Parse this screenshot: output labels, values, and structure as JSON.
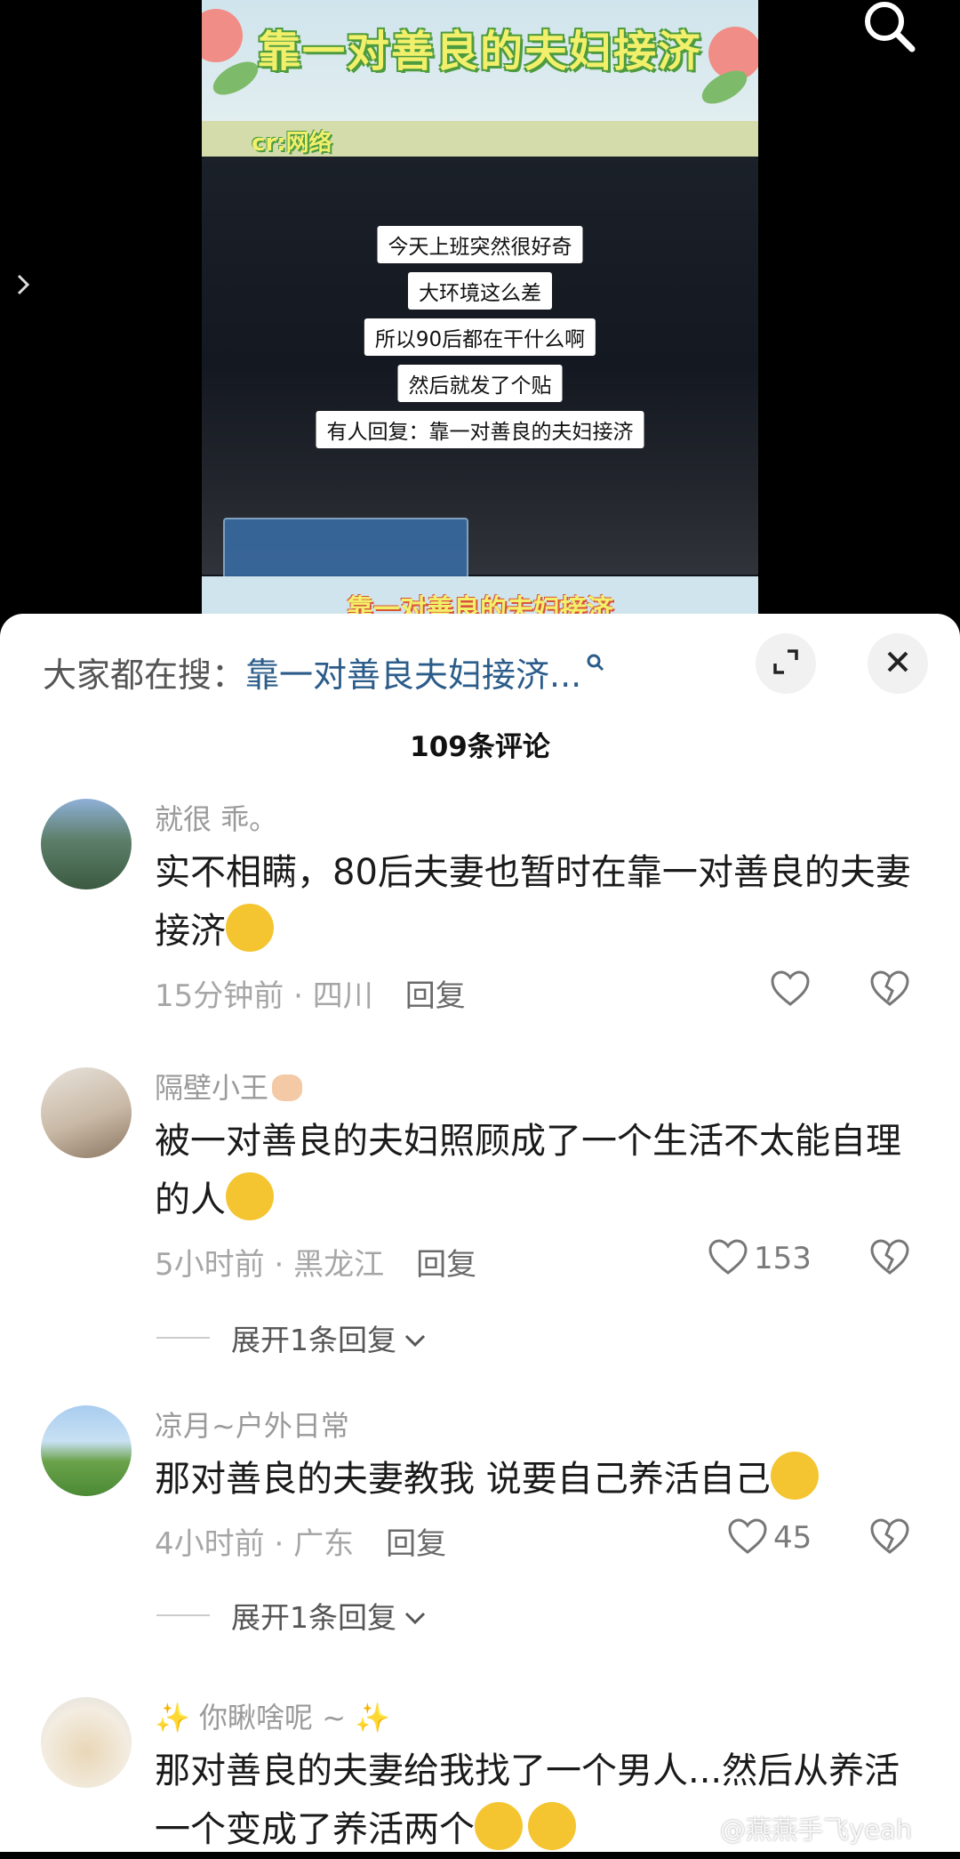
{
  "video": {
    "banner_title": "靠一对善良的夫妇接济",
    "credit": "cr:网络",
    "captions": [
      "今天上班突然很好奇",
      "大环境这么差",
      "所以90后都在干什么啊",
      "然后就发了个贴",
      "有人回复：靠一对善良的夫妇接济"
    ],
    "banner_bottom": "靠一对善良的夫妇接济",
    "back_icon": "chevron-right-icon",
    "search_icon": "search-icon"
  },
  "sheet": {
    "hot_search_label": "大家都在搜：",
    "hot_search_term": "靠一对善良夫妇接济...",
    "comment_count": "109条评论",
    "expand_icon": "expand-icon",
    "close_icon": "close-icon"
  },
  "comments": [
    {
      "username": "就很 乖。",
      "text": "实不相瞒，80后夫妻也暂时在靠一对善良的夫妻接济",
      "emoji": "crying-face",
      "time": "15分钟前",
      "location": "四川",
      "reply": "回复",
      "likes": ""
    },
    {
      "username": "隔壁小王",
      "text": "被一对善良的夫妇照顾成了一个生活不太能自理的人",
      "emoji": "laughing-crying-face",
      "time": "5小时前",
      "location": "黑龙江",
      "reply": "回复",
      "likes": "153",
      "expand": "展开1条回复"
    },
    {
      "username": "凉月~户外日常",
      "text": "那对善良的夫妻教我 说要自己养活自己",
      "emoji": "dizzy-face",
      "time": "4小时前",
      "location": "广东",
      "reply": "回复",
      "likes": "45",
      "expand": "展开1条回复"
    },
    {
      "username": "你瞅啥呢 ~",
      "text": "那对善良的夫妻给我找了一个男人...然后从养活一个变成了养活两个",
      "emoji": "rolling-laughing-faces"
    }
  ],
  "watermark": "@燕燕手飞yeah",
  "colors": {
    "accent_link": "#2b5c8a",
    "banner_text": "#f2f06a",
    "sheet_bg": "#ffffff"
  }
}
